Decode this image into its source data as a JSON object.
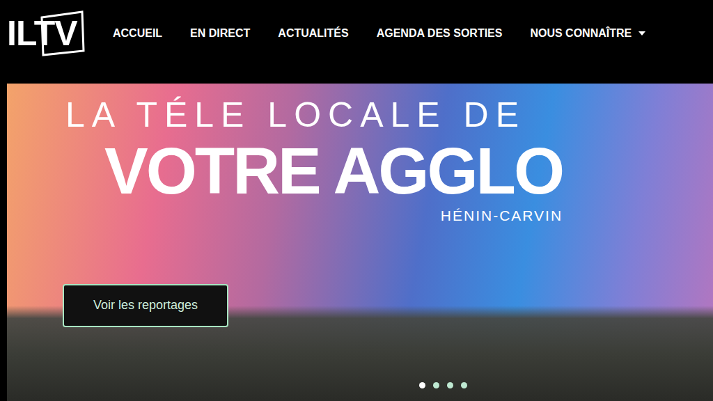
{
  "header": {
    "logo": "ILTV",
    "nav": [
      {
        "label": "ACCUEIL",
        "has_menu": false
      },
      {
        "label": "EN DIRECT",
        "has_menu": false
      },
      {
        "label": "ACTUALITÉS",
        "has_menu": false
      },
      {
        "label": "AGENDA DES SORTIES",
        "has_menu": false
      },
      {
        "label": "NOUS CONNAÎTRE",
        "has_menu": true
      }
    ]
  },
  "hero": {
    "kicker": "LA TÉLE LOCALE DE",
    "title": "VOTRE AGGLO",
    "subtitle": "HÉNIN-CARVIN",
    "button": "Voir les reportages",
    "slides": [
      {
        "selected": true
      },
      {
        "selected": false
      },
      {
        "selected": false
      },
      {
        "selected": false
      }
    ]
  }
}
